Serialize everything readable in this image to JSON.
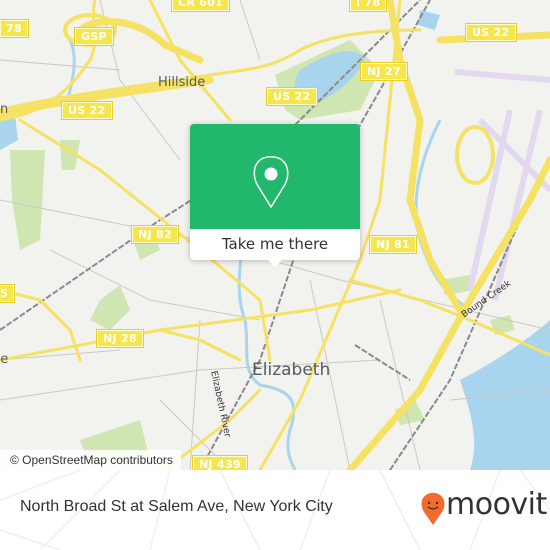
{
  "map": {
    "attribution": "© OpenStreetMap contributors",
    "shields": [
      {
        "label": "78",
        "id": "i78-west"
      },
      {
        "label": "GSP",
        "id": "gsp"
      },
      {
        "label": "CR 601",
        "id": "cr601"
      },
      {
        "label": "I 78",
        "id": "i78-east"
      },
      {
        "label": "US 22",
        "id": "us22-west"
      },
      {
        "label": "US 22",
        "id": "us22-center"
      },
      {
        "label": "US 22",
        "id": "us22-east"
      },
      {
        "label": "NJ 27",
        "id": "nj27"
      },
      {
        "label": "NJ 82",
        "id": "nj82"
      },
      {
        "label": "NJ 81",
        "id": "nj81"
      },
      {
        "label": "5",
        "id": "route5"
      },
      {
        "label": "NJ 28",
        "id": "nj28"
      },
      {
        "label": "NJ 439",
        "id": "nj439"
      }
    ],
    "places": [
      {
        "label": "Hillside"
      },
      {
        "label": "Elizabeth"
      },
      {
        "label": "n"
      },
      {
        "label": "de"
      }
    ],
    "water_labels": [
      {
        "label": "Elizabeth River"
      },
      {
        "label": "Bound Creek"
      }
    ]
  },
  "popup": {
    "icon": "location-pin-icon",
    "button_label": "Take me there",
    "color": "#21b86b"
  },
  "footer": {
    "address": "North Broad St at Salem Ave, New York City",
    "brand": "moovit",
    "brand_color": "#f26a2e"
  }
}
